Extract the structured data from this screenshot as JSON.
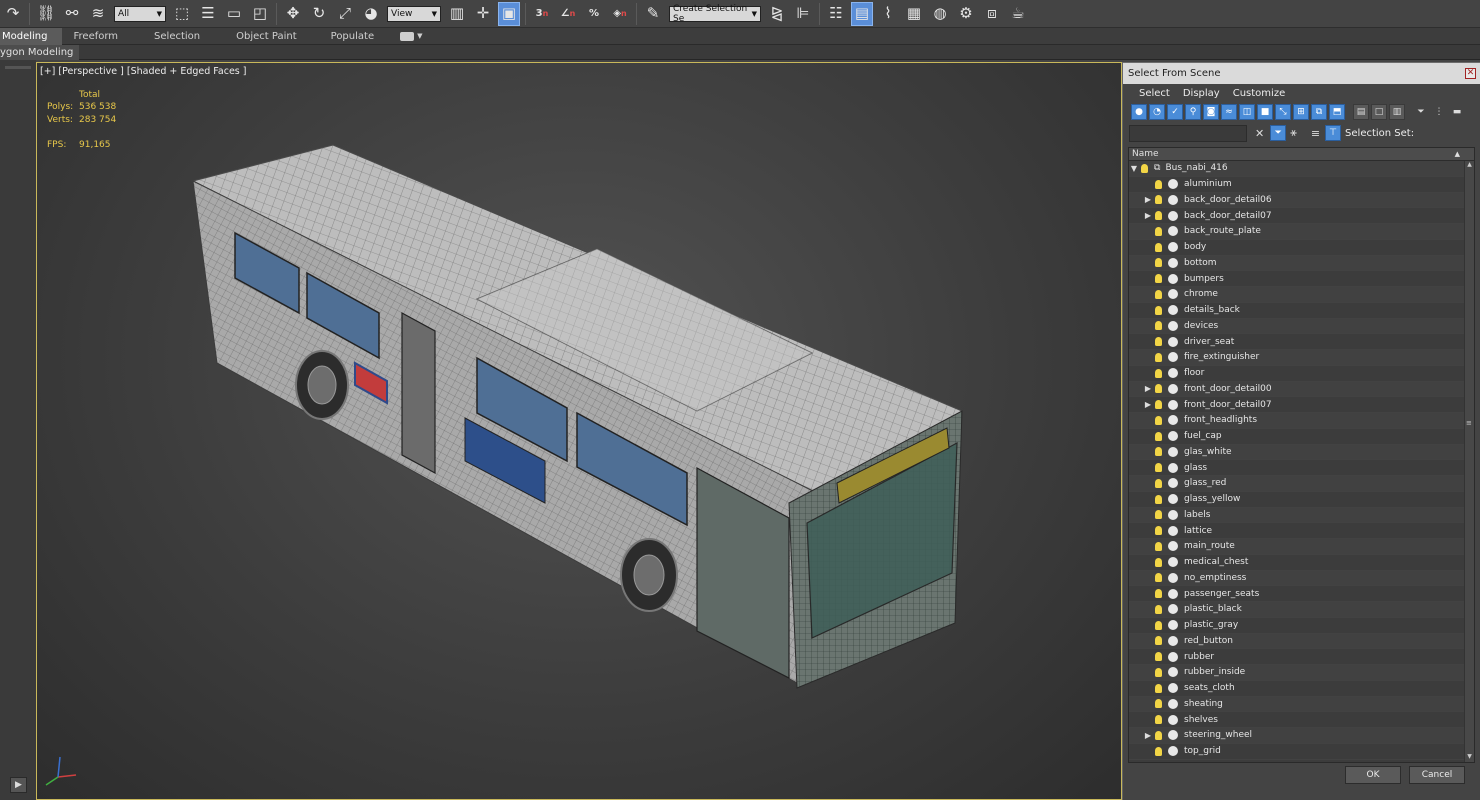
{
  "toolbar": {
    "filter_value": "All",
    "refcoord_value": "View",
    "selection_set_placeholder": "Create Selection Se",
    "snap_3_label": "3",
    "snap_n_label": "n",
    "snap_a_label": "n",
    "percent_label": "%",
    "spinner_label": "n"
  },
  "ribbon": {
    "tabs": [
      "Modeling",
      "Freeform",
      "Selection",
      "Object Paint",
      "Populate"
    ],
    "panel_label": "ygon Modeling"
  },
  "viewport": {
    "label": "[+] [Perspective ] [Shaded + Edged Faces ]",
    "stats": {
      "total_label": "Total",
      "polys_label": "Polys:",
      "polys_value": "536 538",
      "verts_label": "Verts:",
      "verts_value": "283 754",
      "fps_label": "FPS:",
      "fps_value": "91,165"
    },
    "colors": {
      "border": "#c9b85a",
      "stats": "#e8c84a"
    }
  },
  "dialog": {
    "title": "Select From Scene",
    "menu": [
      "Select",
      "Display",
      "Customize"
    ],
    "search_placeholder": "",
    "selection_set_label": "Selection Set:",
    "column_name": "Name",
    "root": "Bus_nabi_416",
    "items": [
      {
        "label": "aluminium",
        "expandable": false
      },
      {
        "label": "back_door_detail06",
        "expandable": true
      },
      {
        "label": "back_door_detail07",
        "expandable": true
      },
      {
        "label": "back_route_plate",
        "expandable": false
      },
      {
        "label": "body",
        "expandable": false
      },
      {
        "label": "bottom",
        "expandable": false
      },
      {
        "label": "bumpers",
        "expandable": false
      },
      {
        "label": "chrome",
        "expandable": false
      },
      {
        "label": "details_back",
        "expandable": false
      },
      {
        "label": "devices",
        "expandable": false
      },
      {
        "label": "driver_seat",
        "expandable": false
      },
      {
        "label": "fire_extinguisher",
        "expandable": false
      },
      {
        "label": "floor",
        "expandable": false
      },
      {
        "label": "front_door_detail00",
        "expandable": true
      },
      {
        "label": "front_door_detail07",
        "expandable": true
      },
      {
        "label": "front_headlights",
        "expandable": false
      },
      {
        "label": "fuel_cap",
        "expandable": false
      },
      {
        "label": "glas_white",
        "expandable": false
      },
      {
        "label": "glass",
        "expandable": false
      },
      {
        "label": "glass_red",
        "expandable": false
      },
      {
        "label": "glass_yellow",
        "expandable": false
      },
      {
        "label": "labels",
        "expandable": false
      },
      {
        "label": "lattice",
        "expandable": false
      },
      {
        "label": "main_route",
        "expandable": false
      },
      {
        "label": "medical_chest",
        "expandable": false
      },
      {
        "label": "no_emptiness",
        "expandable": false
      },
      {
        "label": "passenger_seats",
        "expandable": false
      },
      {
        "label": "plastic_black",
        "expandable": false
      },
      {
        "label": "plastic_gray",
        "expandable": false
      },
      {
        "label": "red_button",
        "expandable": false
      },
      {
        "label": "rubber",
        "expandable": false
      },
      {
        "label": "rubber_inside",
        "expandable": false
      },
      {
        "label": "seats_cloth",
        "expandable": false
      },
      {
        "label": "sheating",
        "expandable": false
      },
      {
        "label": "shelves",
        "expandable": false
      },
      {
        "label": "steering_wheel",
        "expandable": true
      },
      {
        "label": "top_grid",
        "expandable": false
      }
    ],
    "ok_label": "OK",
    "cancel_label": "Cancel",
    "colors": {
      "accent": "#4a8cd8",
      "bulb": "#f2d546"
    }
  }
}
